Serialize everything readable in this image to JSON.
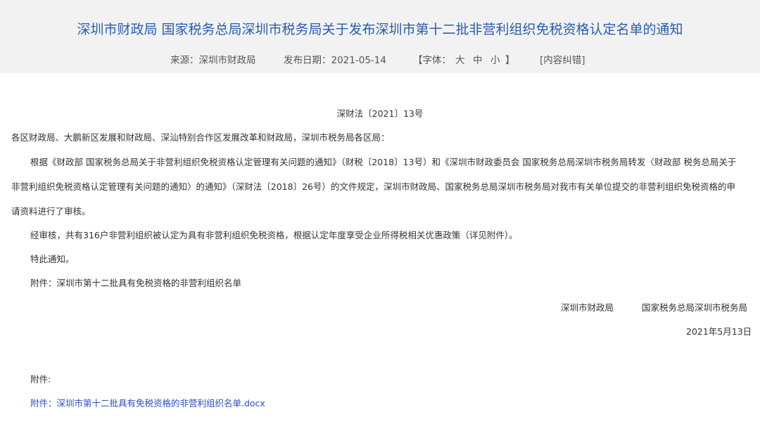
{
  "header": {
    "title": "深圳市财政局 国家税务总局深圳市税务局关于发布深圳市第十二批非营利组织免税资格认定名单的通知",
    "source": "来源：深圳市财政局",
    "publish_date": "发布日期：2021-05-14",
    "font_size_label": "【字体：",
    "font_size_large": "大",
    "font_size_medium": "中",
    "font_size_small": "小",
    "font_size_close": "】",
    "error_report": "[内容纠错]"
  },
  "article": {
    "doc_number": "深财法〔2021〕13号",
    "recipients": "各区财政局、大鹏新区发展和财政局、深汕特别合作区发展改革和财政局，深圳市税务局各区局：",
    "para1_line1": "根据《财政部 国家税务总局关于非营利组织免税资格认定管理有关问题的通知》（财税〔2018〕13号）和《深圳市财政委员会 国家税务总局深圳市税务局转发〈财政部 税务总局关于",
    "para1_line2": "非营利组织免税资格认定管理有关问题的通知〉的通知》（深财法〔2018〕26号）的文件规定，深圳市财政局、国家税务总局深圳市税务局对我市有关单位提交的非营利组织免税资格的申",
    "para1_line3": "请资料进行了审核。",
    "para2": "经审核，共有316户非营利组织被认定为具有非营利组织免税资格，根据认定年度享受企业所得税相关优惠政策（详见附件）。",
    "para3": "特此通知。",
    "attachment_note": "附件：深圳市第十二批具有免税资格的非营利组织名单",
    "signer1": "深圳市财政局",
    "signer2": "国家税务总局深圳市税务局",
    "sign_date": "2021年5月13日",
    "attachments_label": "附件:",
    "attachment_link": "附件：深圳市第十二批具有免税资格的非营利组织名单.docx"
  }
}
